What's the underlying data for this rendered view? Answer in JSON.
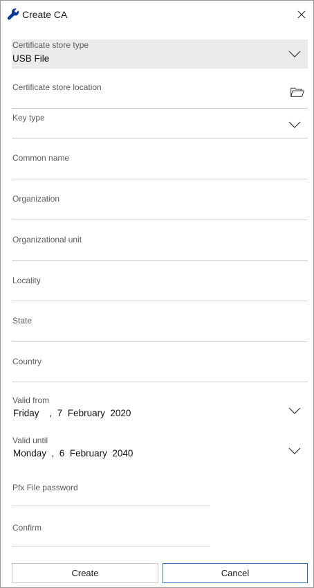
{
  "window": {
    "title": "Create CA"
  },
  "fields": {
    "store_type": {
      "label": "Certificate store type",
      "value": "USB File"
    },
    "store_location": {
      "label": "Certificate store location"
    },
    "key_type": {
      "label": "Key type"
    },
    "common_name": {
      "label": "Common name"
    },
    "organization": {
      "label": "Organization"
    },
    "org_unit": {
      "label": "Organizational unit"
    },
    "locality": {
      "label": "Locality"
    },
    "state": {
      "label": "State"
    },
    "country": {
      "label": "Country"
    },
    "valid_from": {
      "label": "Valid from",
      "weekday": "Friday",
      "day": "7",
      "month": "February",
      "year": "2020"
    },
    "valid_until": {
      "label": "Valid until",
      "weekday": "Monday",
      "day": "6",
      "month": "February",
      "year": "2040"
    },
    "pfx_password": {
      "label": "Pfx File password"
    },
    "confirm": {
      "label": "Confirm"
    }
  },
  "buttons": {
    "create": "Create",
    "cancel": "Cancel"
  },
  "icons": {
    "title": "wrench-icon",
    "close": "close-icon",
    "dropdown": "chevron-down-icon",
    "browse": "folder-icon"
  },
  "colors": {
    "accent": "#2f6fb3",
    "icon": "#0a3a9e",
    "field_bg": "#ebebeb"
  }
}
